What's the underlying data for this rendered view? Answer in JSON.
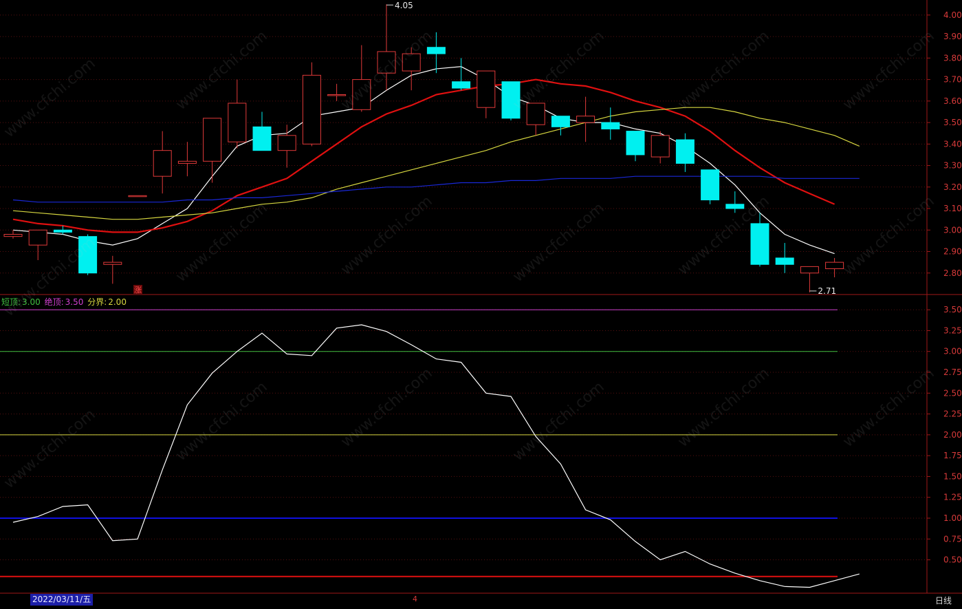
{
  "main_axis_ticks": [
    "4.00",
    "3.90",
    "3.80",
    "3.70",
    "3.60",
    "3.50",
    "3.40",
    "3.30",
    "3.20",
    "3.10",
    "3.00",
    "2.90",
    "2.80"
  ],
  "sub_axis_ticks": [
    "3.50",
    "3.25",
    "3.00",
    "2.75",
    "2.50",
    "2.25",
    "2.00",
    "1.75",
    "1.50",
    "1.25",
    "1.00",
    "0.75",
    "0.50"
  ],
  "high_label": "4.05",
  "low_label": "2.71",
  "zhang_label": "涨",
  "legend": {
    "short_top_label": "短顶:",
    "short_top_value": "3.00",
    "abs_top_label": "绝顶:",
    "abs_top_value": "3.50",
    "divide_label": "分界:",
    "divide_value": "2.00"
  },
  "date_label": "2022/03/11/五",
  "cursor_number": "4",
  "period_label": "日线",
  "watermark_text": "www.cfchi.com",
  "colors": {
    "up": "#e23a3a",
    "down": "#00f0f0",
    "ma5": "#ffffff",
    "ma10": "#e01010",
    "ma20": "#d8d840",
    "ma60": "#1a28d8",
    "short_top": "#40c040",
    "abs_top": "#d040d0",
    "divide": "#d8d840",
    "blue_line": "#1010e0",
    "red_line": "#e01010",
    "indicator": "#ffffff"
  },
  "chart_data": [
    {
      "type": "candlestick",
      "y_range": [
        2.7,
        4.07
      ],
      "candles": [
        {
          "o": 2.97,
          "h": 3.0,
          "l": 2.96,
          "c": 2.98
        },
        {
          "o": 2.93,
          "h": 3.0,
          "l": 2.86,
          "c": 3.0
        },
        {
          "o": 3.0,
          "h": 3.02,
          "l": 2.98,
          "c": 2.99
        },
        {
          "o": 2.97,
          "h": 2.98,
          "l": 2.79,
          "c": 2.8
        },
        {
          "o": 2.84,
          "h": 2.88,
          "l": 2.75,
          "c": 2.85
        },
        {
          "o": 3.16,
          "h": 3.16,
          "l": 3.16,
          "c": 3.16
        },
        {
          "o": 3.25,
          "h": 3.46,
          "l": 3.17,
          "c": 3.37
        },
        {
          "o": 3.31,
          "h": 3.41,
          "l": 3.25,
          "c": 3.32
        },
        {
          "o": 3.32,
          "h": 3.48,
          "l": 3.22,
          "c": 3.52
        },
        {
          "o": 3.41,
          "h": 3.7,
          "l": 3.38,
          "c": 3.59
        },
        {
          "o": 3.48,
          "h": 3.55,
          "l": 3.37,
          "c": 3.37
        },
        {
          "o": 3.37,
          "h": 3.49,
          "l": 3.29,
          "c": 3.44
        },
        {
          "o": 3.4,
          "h": 3.78,
          "l": 3.39,
          "c": 3.72
        },
        {
          "o": 3.63,
          "h": 3.68,
          "l": 3.6,
          "c": 3.63
        },
        {
          "o": 3.56,
          "h": 3.86,
          "l": 3.55,
          "c": 3.7
        },
        {
          "o": 3.73,
          "h": 4.05,
          "l": 3.65,
          "c": 3.83
        },
        {
          "o": 3.74,
          "h": 3.85,
          "l": 3.65,
          "c": 3.82
        },
        {
          "o": 3.85,
          "h": 3.92,
          "l": 3.73,
          "c": 3.82
        },
        {
          "o": 3.69,
          "h": 3.8,
          "l": 3.65,
          "c": 3.66
        },
        {
          "o": 3.57,
          "h": 3.74,
          "l": 3.52,
          "c": 3.74
        },
        {
          "o": 3.69,
          "h": 3.69,
          "l": 3.51,
          "c": 3.52
        },
        {
          "o": 3.49,
          "h": 3.59,
          "l": 3.44,
          "c": 3.59
        },
        {
          "o": 3.53,
          "h": 3.53,
          "l": 3.44,
          "c": 3.48
        },
        {
          "o": 3.5,
          "h": 3.62,
          "l": 3.41,
          "c": 3.53
        },
        {
          "o": 3.5,
          "h": 3.57,
          "l": 3.42,
          "c": 3.47
        },
        {
          "o": 3.46,
          "h": 3.46,
          "l": 3.32,
          "c": 3.35
        },
        {
          "o": 3.34,
          "h": 3.46,
          "l": 3.31,
          "c": 3.44
        },
        {
          "o": 3.42,
          "h": 3.45,
          "l": 3.27,
          "c": 3.31
        },
        {
          "o": 3.28,
          "h": 3.28,
          "l": 3.12,
          "c": 3.14
        },
        {
          "o": 3.12,
          "h": 3.18,
          "l": 3.08,
          "c": 3.1
        },
        {
          "o": 3.03,
          "h": 3.08,
          "l": 2.83,
          "c": 2.84
        },
        {
          "o": 2.87,
          "h": 2.94,
          "l": 2.8,
          "c": 2.84
        },
        {
          "o": 2.8,
          "h": 2.83,
          "l": 2.71,
          "c": 2.83
        },
        {
          "o": 2.82,
          "h": 2.87,
          "l": 2.78,
          "c": 2.85
        }
      ],
      "ma_series": [
        {
          "key": "ma5",
          "values": [
            3.0,
            2.99,
            2.98,
            2.95,
            2.93,
            2.96,
            3.03,
            3.1,
            3.25,
            3.39,
            3.44,
            3.45,
            3.53,
            3.55,
            3.57,
            3.65,
            3.72,
            3.75,
            3.76,
            3.7,
            3.62,
            3.58,
            3.52,
            3.5,
            3.5,
            3.47,
            3.45,
            3.39,
            3.31,
            3.21,
            3.08,
            2.98,
            2.93,
            2.89
          ]
        },
        {
          "key": "ma10",
          "values": [
            3.05,
            3.03,
            3.02,
            3.0,
            2.99,
            2.99,
            3.01,
            3.04,
            3.09,
            3.16,
            3.2,
            3.24,
            3.32,
            3.4,
            3.48,
            3.54,
            3.58,
            3.63,
            3.65,
            3.67,
            3.68,
            3.7,
            3.68,
            3.67,
            3.64,
            3.6,
            3.57,
            3.53,
            3.46,
            3.37,
            3.29,
            3.22,
            3.17,
            3.12
          ]
        },
        {
          "key": "ma20",
          "values": [
            3.09,
            3.08,
            3.07,
            3.06,
            3.05,
            3.05,
            3.06,
            3.07,
            3.08,
            3.1,
            3.12,
            3.13,
            3.15,
            3.19,
            3.22,
            3.25,
            3.28,
            3.31,
            3.34,
            3.37,
            3.41,
            3.44,
            3.47,
            3.5,
            3.53,
            3.55,
            3.56,
            3.57,
            3.57,
            3.55,
            3.52,
            3.5,
            3.47,
            3.44,
            3.39
          ]
        },
        {
          "key": "ma60",
          "values": [
            3.14,
            3.13,
            3.13,
            3.13,
            3.13,
            3.13,
            3.13,
            3.14,
            3.14,
            3.15,
            3.15,
            3.16,
            3.17,
            3.18,
            3.19,
            3.2,
            3.2,
            3.21,
            3.22,
            3.22,
            3.23,
            3.23,
            3.24,
            3.24,
            3.24,
            3.25,
            3.25,
            3.25,
            3.25,
            3.25,
            3.25,
            3.24,
            3.24,
            3.24,
            3.24
          ]
        }
      ]
    },
    {
      "type": "line",
      "y_range": [
        0.1,
        3.65
      ],
      "hlines": [
        {
          "key": "abs_top",
          "value": 3.5
        },
        {
          "key": "short_top",
          "value": 3.0
        },
        {
          "key": "divide",
          "value": 2.0
        },
        {
          "key": "blue_line",
          "value": 1.0
        },
        {
          "key": "red_line",
          "value": 0.3
        }
      ],
      "series": [
        {
          "key": "indicator",
          "values": [
            0.95,
            1.02,
            1.14,
            1.16,
            0.73,
            0.75,
            1.58,
            2.36,
            2.74,
            3.0,
            3.22,
            2.97,
            2.95,
            3.28,
            3.32,
            3.24,
            3.08,
            2.91,
            2.87,
            2.5,
            2.46,
            1.98,
            1.65,
            1.1,
            0.98,
            0.72,
            0.5,
            0.6,
            0.45,
            0.34,
            0.25,
            0.18,
            0.17,
            0.25,
            0.33
          ]
        }
      ]
    }
  ]
}
